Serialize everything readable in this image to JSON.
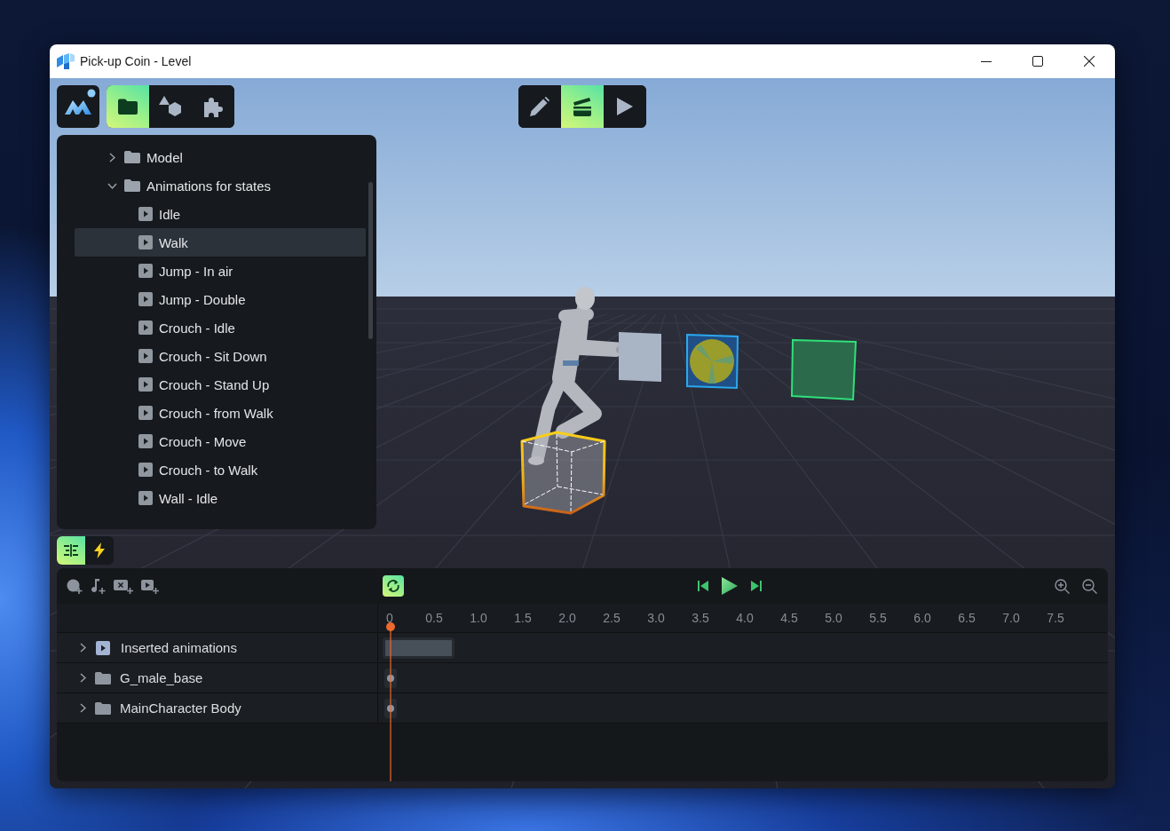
{
  "window": {
    "title": "Pick-up Coin - Level"
  },
  "main_toolbar": {
    "tabs": [
      {
        "kind": "files",
        "selected": true
      },
      {
        "kind": "shapes",
        "selected": false
      },
      {
        "kind": "plugins",
        "selected": false
      }
    ]
  },
  "mode_toolbar": {
    "modes": [
      {
        "kind": "edit",
        "selected": false
      },
      {
        "kind": "animate",
        "selected": true
      },
      {
        "kind": "play",
        "selected": false
      }
    ]
  },
  "tree": {
    "items": [
      {
        "kind": "folder",
        "label": "Model",
        "expanded": false,
        "selected": false
      },
      {
        "kind": "folder",
        "label": "Animations for states",
        "expanded": true,
        "selected": false,
        "children": [
          {
            "kind": "animation",
            "label": "Idle",
            "selected": false
          },
          {
            "kind": "animation",
            "label": "Walk",
            "selected": true
          },
          {
            "kind": "animation",
            "label": "Jump - In air",
            "selected": false
          },
          {
            "kind": "animation",
            "label": "Jump - Double",
            "selected": false
          },
          {
            "kind": "animation",
            "label": "Crouch - Idle",
            "selected": false
          },
          {
            "kind": "animation",
            "label": "Crouch - Sit Down",
            "selected": false
          },
          {
            "kind": "animation",
            "label": "Crouch - Stand Up",
            "selected": false
          },
          {
            "kind": "animation",
            "label": "Crouch - from Walk",
            "selected": false
          },
          {
            "kind": "animation",
            "label": "Crouch - Move",
            "selected": false
          },
          {
            "kind": "animation",
            "label": "Crouch - to Walk",
            "selected": false
          },
          {
            "kind": "animation",
            "label": "Wall - Idle",
            "selected": false
          }
        ]
      }
    ]
  },
  "panel_tabs": [
    {
      "kind": "timeline",
      "selected": true
    },
    {
      "kind": "events",
      "selected": false
    }
  ],
  "timeline": {
    "loop": true,
    "ruler": [
      "0",
      "0.5",
      "1.0",
      "1.5",
      "2.0",
      "2.5",
      "3.0",
      "3.5",
      "4.0",
      "4.5",
      "5.0",
      "5.5",
      "6.0",
      "6.5",
      "7.0",
      "7.5"
    ],
    "tracks": [
      {
        "kind": "animation",
        "label": "Inserted animations",
        "expanded": false
      },
      {
        "kind": "folder",
        "label": "G_male_base",
        "expanded": false
      },
      {
        "kind": "folder",
        "label": "MainCharacter Body",
        "expanded": false
      }
    ]
  }
}
